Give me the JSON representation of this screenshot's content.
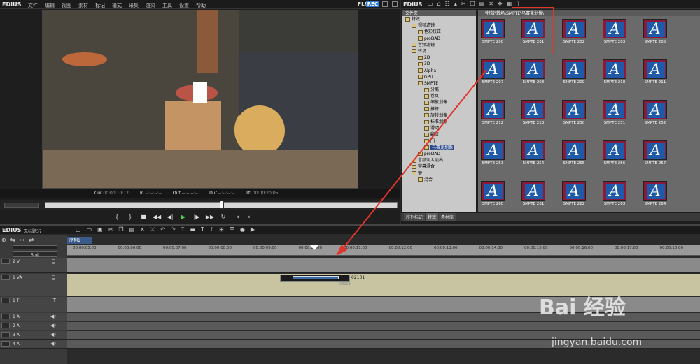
{
  "player": {
    "app": "EDIUS",
    "menu": [
      "文件",
      "编辑",
      "视图",
      "素材",
      "标记",
      "模式",
      "采集",
      "渲染",
      "工具",
      "设置",
      "帮助"
    ],
    "plr": "PLR",
    "rec": "REC",
    "timecodes": [
      {
        "label": "Cur",
        "value": "00:00:10:12"
      },
      {
        "label": "In",
        "value": "--:--:--:--"
      },
      {
        "label": "Out",
        "value": "--:--:--:--"
      },
      {
        "label": "Dur",
        "value": "--:--:--:--"
      },
      {
        "label": "Ttl",
        "value": "00:00:20:05"
      }
    ]
  },
  "library": {
    "app": "EDIUS",
    "folder_header": "文件夹",
    "path": "\\特效\\转场\\SMPTE\\马赛克划像\\",
    "tree": [
      {
        "label": "特效",
        "indent": 0,
        "sel": false
      },
      {
        "label": "视频滤镜",
        "indent": 1,
        "sel": false
      },
      {
        "label": "色彩校正",
        "indent": 2,
        "sel": false
      },
      {
        "label": "proDAD",
        "indent": 2,
        "sel": false
      },
      {
        "label": "音频滤镜",
        "indent": 1,
        "sel": false
      },
      {
        "label": "转场",
        "indent": 1,
        "sel": false
      },
      {
        "label": "2D",
        "indent": 2,
        "sel": false
      },
      {
        "label": "3D",
        "indent": 2,
        "sel": false
      },
      {
        "label": "Alpha",
        "indent": 2,
        "sel": false
      },
      {
        "label": "GPU",
        "indent": 2,
        "sel": false
      },
      {
        "label": "SMPTE",
        "indent": 2,
        "sel": false
      },
      {
        "label": "分离",
        "indent": 3,
        "sel": false
      },
      {
        "label": "卷页",
        "indent": 3,
        "sel": false
      },
      {
        "label": "缩放划像",
        "indent": 3,
        "sel": false
      },
      {
        "label": "推挤",
        "indent": 3,
        "sel": false
      },
      {
        "label": "旋转划像",
        "indent": 3,
        "sel": false
      },
      {
        "label": "标准划像",
        "indent": 3,
        "sel": false
      },
      {
        "label": "滑动",
        "indent": 3,
        "sel": false
      },
      {
        "label": "翻页",
        "indent": 3,
        "sel": false
      },
      {
        "label": "门",
        "indent": 3,
        "sel": false
      },
      {
        "label": "马赛克划像",
        "indent": 3,
        "sel": true
      },
      {
        "label": "proDAD",
        "indent": 2,
        "sel": false
      },
      {
        "label": "音频淡入淡出",
        "indent": 1,
        "sel": false
      },
      {
        "label": "字幕混合",
        "indent": 1,
        "sel": false
      },
      {
        "label": "键",
        "indent": 1,
        "sel": false
      },
      {
        "label": "混合",
        "indent": 2,
        "sel": false
      }
    ],
    "thumbs": [
      [
        "SMPTE 200",
        "SMPTE 201",
        "SMPTE 202",
        "SMPTE 203",
        "SMPTE 205"
      ],
      [
        "SMPTE 207",
        "SMPTE 208",
        "SMPTE 209",
        "SMPTE 210",
        "SMPTE 211"
      ],
      [
        "SMPTE 212",
        "SMPTE 213",
        "SMPTE 250",
        "SMPTE 251",
        "SMPTE 252"
      ],
      [
        "SMPTE 253",
        "SMPTE 254",
        "SMPTE 255",
        "SMPTE 256",
        "SMPTE 257"
      ],
      [
        "SMPTE 260",
        "SMPTE 261",
        "SMPTE 262",
        "SMPTE 263",
        "SMPTE 264"
      ]
    ],
    "tabs": [
      "序列标记",
      "特效",
      "素材库"
    ]
  },
  "timeline": {
    "app": "EDIUS",
    "project": "无标题37",
    "sequence": "序列1",
    "ruler": [
      "00:00:05:00",
      "00:00:06:00",
      "00:00:07:00",
      "00:00:08:00",
      "00:00:09:00",
      "00:00:10:00",
      "00:00:11:00",
      "00:00:12:00",
      "00:00:13:00",
      "00:00:14:00",
      "00:00:15:00",
      "00:00:16:00",
      "00:00:17:00",
      "00:00:18:00"
    ],
    "zoom": "5 帧",
    "tracks": [
      {
        "name": "2 V",
        "icon": "目"
      },
      {
        "name": "1 VA",
        "icon": "目"
      },
      {
        "name": "1 T",
        "icon": "T"
      },
      {
        "name": "1 A",
        "icon": "◀)"
      },
      {
        "name": "2 A",
        "icon": "◀)"
      },
      {
        "name": "3 A",
        "icon": "◀)"
      },
      {
        "name": "4 A",
        "icon": "◀)"
      }
    ],
    "clip_label": "02101",
    "audio_label": "02101"
  },
  "watermark": {
    "brand": "Bai 经验",
    "url": "jingyan.baidu.com"
  },
  "colors": {
    "accent": "#2a7ad0",
    "selection": "#e0352b",
    "thumb_red": "#8a1a3a",
    "thumb_blue": "#1e5aa8"
  }
}
